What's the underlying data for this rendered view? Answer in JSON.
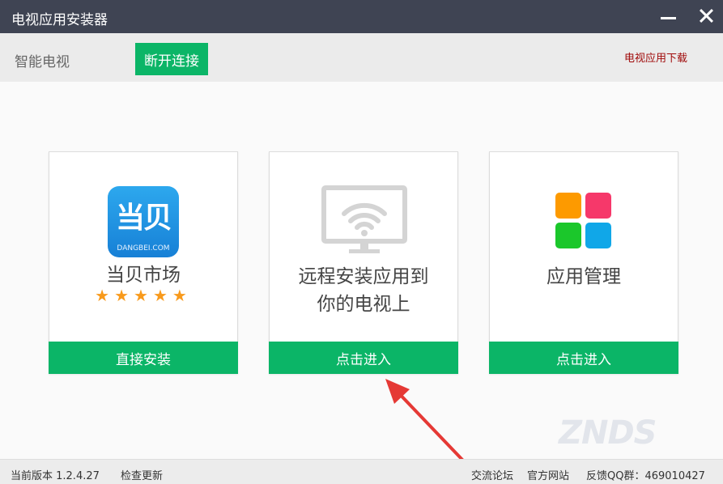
{
  "window": {
    "title": "电视应用安装器",
    "minimize_icon": "minimize-icon",
    "close_icon": "close-icon"
  },
  "toolbar": {
    "device_name": "智能电视",
    "disconnect_label": "断开连接",
    "download_link": "电视应用下载"
  },
  "cards": [
    {
      "title": "当贝市场",
      "logo_text": "当贝",
      "logo_sub": "DANGBEI.COM",
      "rating": 5,
      "button_label": "直接安装"
    },
    {
      "title_line1": "远程安装应用到",
      "title_line2": "你的电视上",
      "icon": "tv-wifi-icon",
      "button_label": "点击进入"
    },
    {
      "title": "应用管理",
      "icon": "app-grid-icon",
      "button_label": "点击进入"
    }
  ],
  "statusbar": {
    "version": "当前版本 1.2.4.27",
    "check_update": "检查更新",
    "forum": "交流论坛",
    "official_site": "官方网站",
    "qq_group": "反馈QQ群：469010427"
  },
  "watermark": "ZNDS",
  "colors": {
    "titlebar": "#3f4453",
    "accent_green": "#0bb567",
    "download_link": "#a00a0a",
    "star": "#f89a1c",
    "annotation_arrow": "#e53935"
  }
}
